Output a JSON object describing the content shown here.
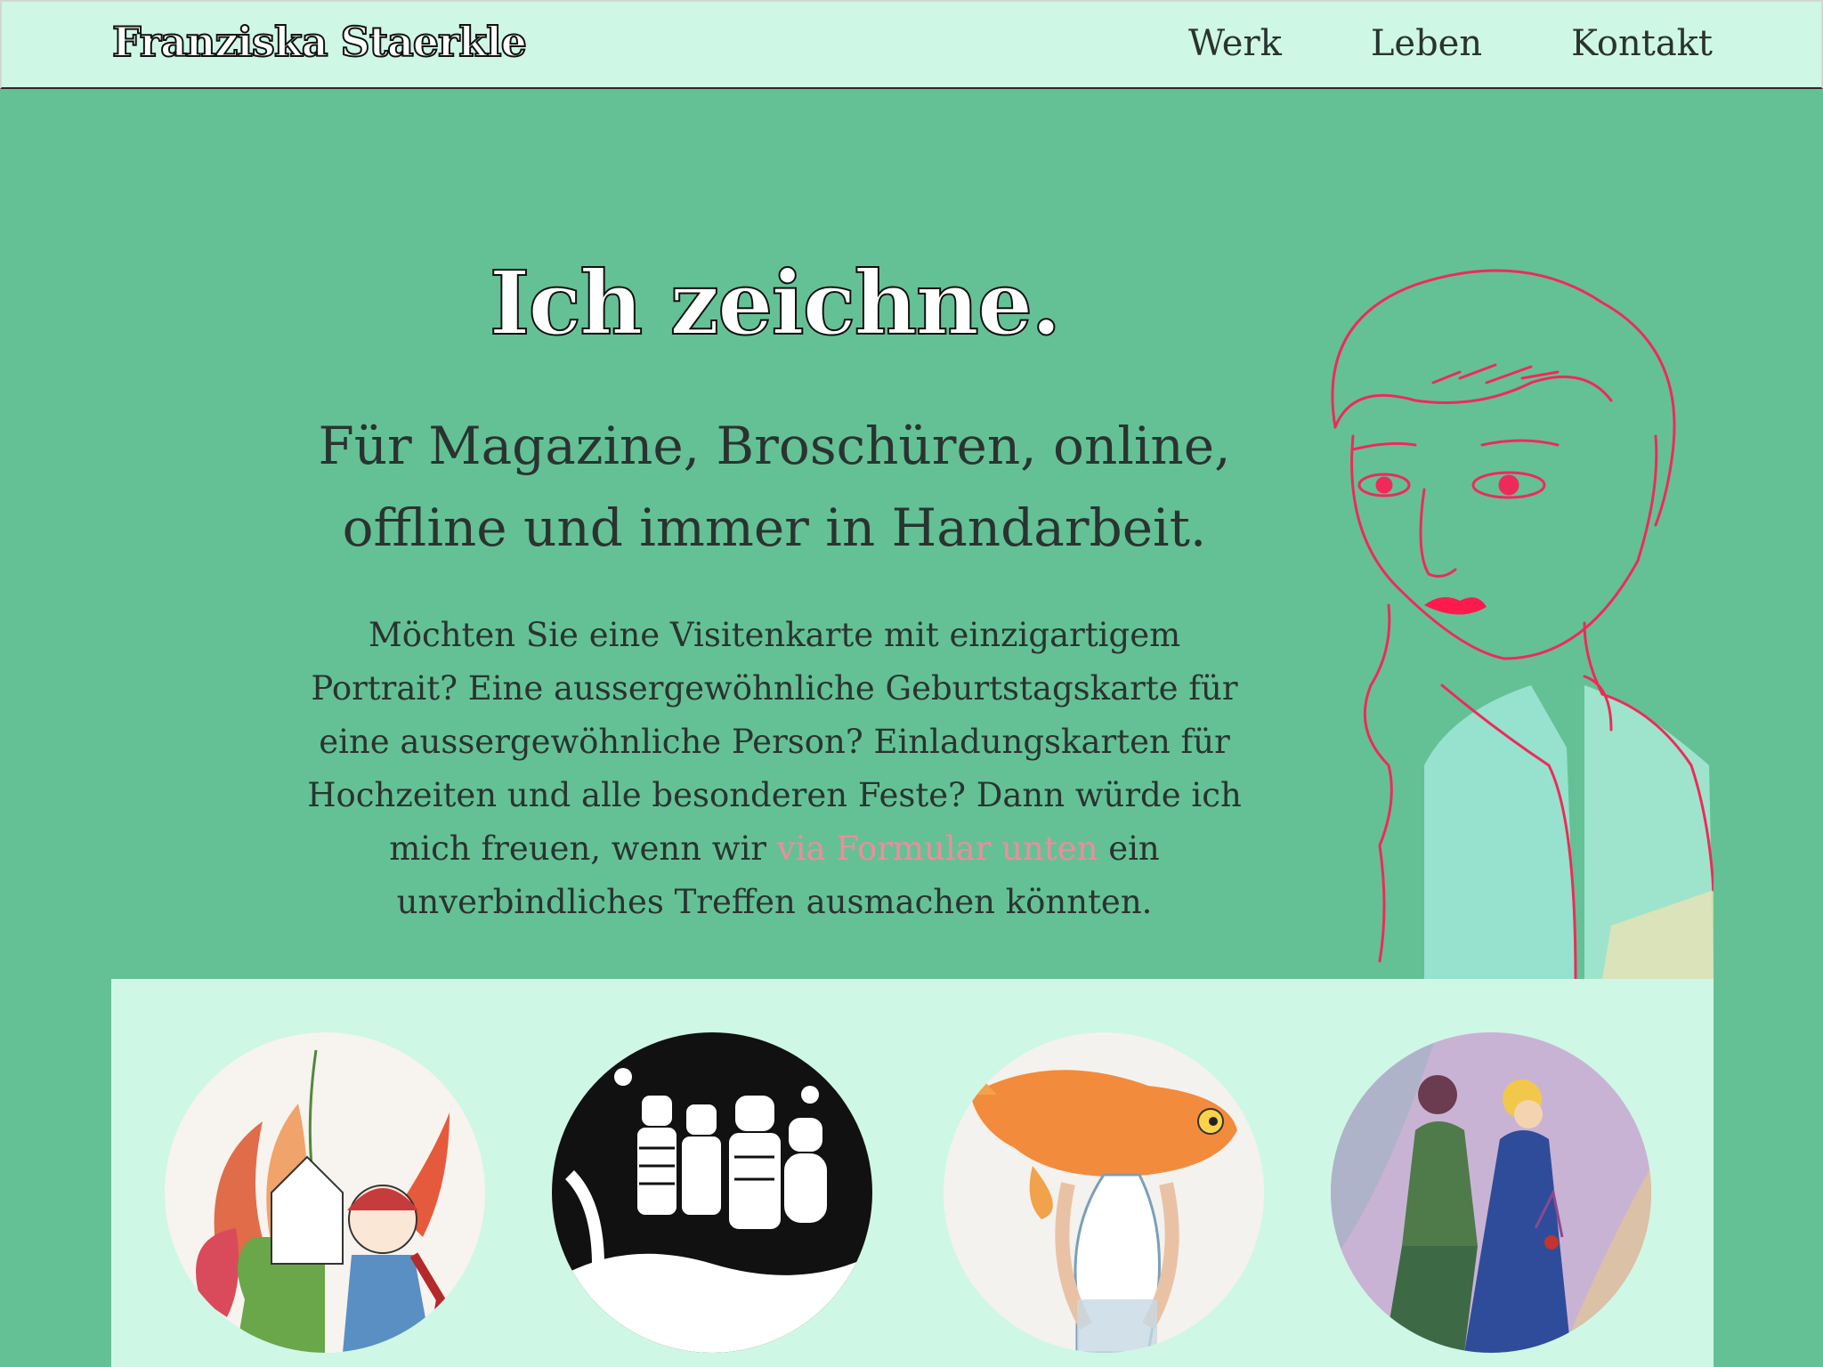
{
  "header": {
    "brand": "Franziska Staerkle",
    "nav": [
      {
        "label": "Werk"
      },
      {
        "label": "Leben"
      },
      {
        "label": "Kontakt"
      }
    ]
  },
  "hero": {
    "title": "Ich zeichne.",
    "subtitle_line1": "Für Magazine, Broschüren, online,",
    "subtitle_line2": "offline und immer in Handarbeit.",
    "body_before_link": "Möchten Sie eine Visitenkarte mit einzigartigem Portrait? Eine aussergewöhnliche Geburtstagskarte für eine aussergewöhnliche Person? Einladungskarten für Hochzeiten und alle besonderen Feste? Dann würde ich mich freuen, wenn wir ",
    "body_link": "via Formular unten",
    "body_after_link": " ein unverbindliches Treffen ausmachen könnten."
  },
  "colors": {
    "page_background": "#64c195",
    "panel_background": "#cff7e5",
    "link": "#f08c9a",
    "text": "#2a3330"
  },
  "gallery": {
    "items": [
      {
        "icon": "illustration-girl-with-plants"
      },
      {
        "icon": "illustration-animal-figures"
      },
      {
        "icon": "illustration-goldfish-head"
      },
      {
        "icon": "illustration-two-women"
      }
    ]
  }
}
